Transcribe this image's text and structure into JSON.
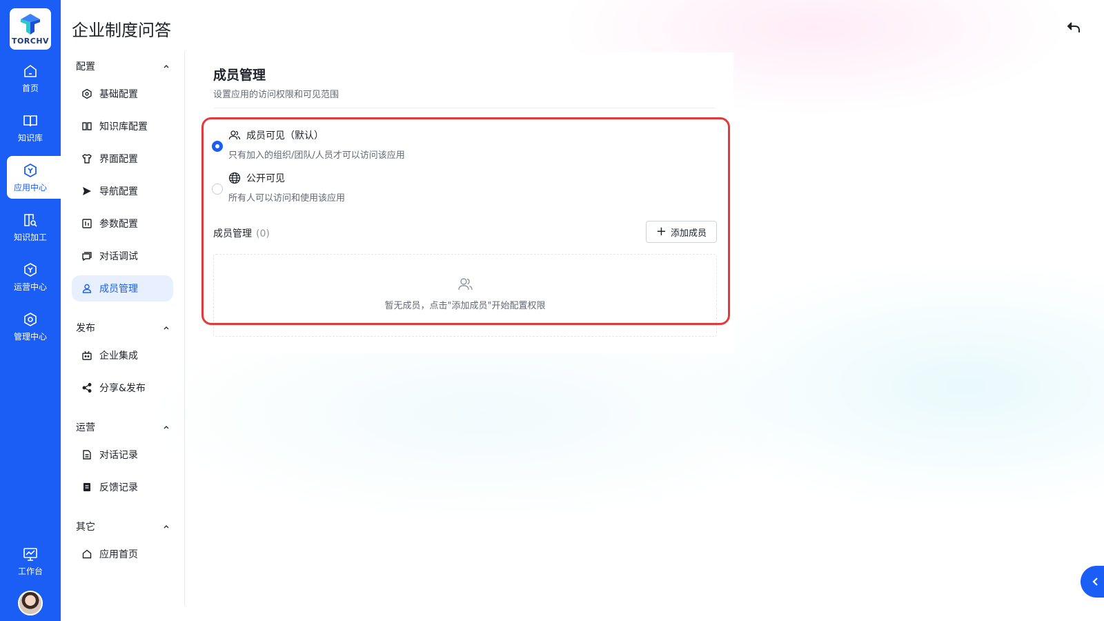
{
  "app": {
    "logo_text": "TORCHV",
    "title": "企业制度问答"
  },
  "rail": {
    "items": [
      {
        "label": "首页",
        "icon": "home-icon"
      },
      {
        "label": "知识库",
        "icon": "book-icon"
      },
      {
        "label": "应用中心",
        "icon": "cube-icon",
        "active": true
      },
      {
        "label": "知识加工",
        "icon": "knowledge-process-icon"
      },
      {
        "label": "运营中心",
        "icon": "cube-icon"
      },
      {
        "label": "管理中心",
        "icon": "settings-icon"
      }
    ],
    "bottom": {
      "workbench_label": "工作台"
    }
  },
  "subnav": {
    "groups": [
      {
        "title": "配置",
        "items": [
          {
            "label": "基础配置",
            "icon": "gear-icon"
          },
          {
            "label": "知识库配置",
            "icon": "book-icon"
          },
          {
            "label": "界面配置",
            "icon": "shirt-icon"
          },
          {
            "label": "导航配置",
            "icon": "send-icon"
          },
          {
            "label": "参数配置",
            "icon": "params-icon"
          },
          {
            "label": "对话调试",
            "icon": "chat-icon"
          },
          {
            "label": "成员管理",
            "icon": "user-icon",
            "active": true
          }
        ]
      },
      {
        "title": "发布",
        "items": [
          {
            "label": "企业集成",
            "icon": "bot-icon"
          },
          {
            "label": "分享&发布",
            "icon": "share-icon"
          }
        ]
      },
      {
        "title": "运营",
        "items": [
          {
            "label": "对话记录",
            "icon": "doc-icon"
          },
          {
            "label": "反馈记录",
            "icon": "doc-filled-icon"
          }
        ]
      },
      {
        "title": "其它",
        "items": [
          {
            "label": "应用首页",
            "icon": "home-icon"
          }
        ]
      }
    ]
  },
  "main": {
    "title": "成员管理",
    "subtitle": "设置应用的访问权限和可见范围",
    "options": [
      {
        "label": "成员可见（默认）",
        "desc": "只有加入的组织/团队/人员才可以访问该应用",
        "checked": true
      },
      {
        "label": "公开可见",
        "desc": "所有人可以访问和使用该应用",
        "checked": false
      }
    ],
    "members_label": "成员管理",
    "members_count": "(0)",
    "add_button": "添加成员",
    "empty_text": "暂无成员，点击\"添加成员\"开始配置权限"
  },
  "colors": {
    "brand": "#1a5ef5",
    "highlight": "#e5383b"
  }
}
